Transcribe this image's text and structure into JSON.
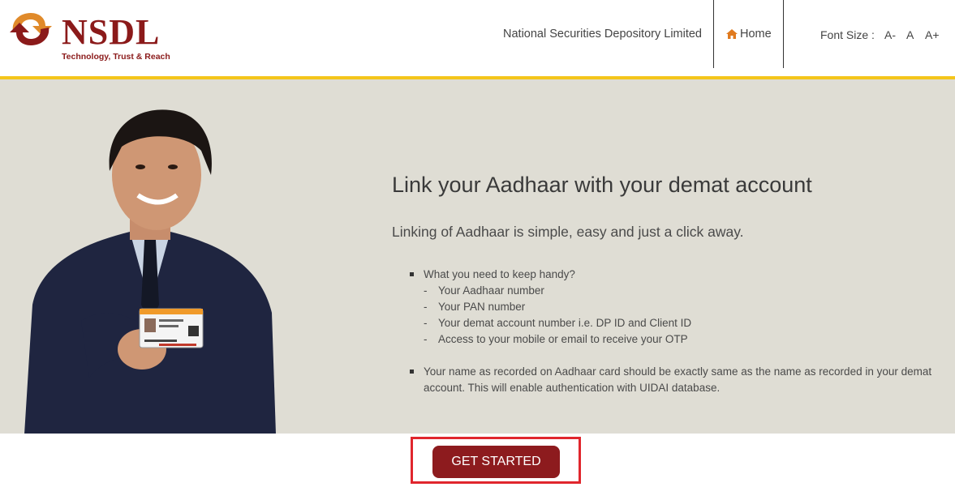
{
  "header": {
    "logo_name": "NSDL",
    "logo_tagline": "Technology, Trust & Reach",
    "org_name": "National Securities Depository Limited",
    "home_label": "Home",
    "font_size_label": "Font Size :",
    "font_decrease": "A-",
    "font_normal": "A",
    "font_increase": "A+"
  },
  "hero": {
    "headline": "Link your Aadhaar with your demat account",
    "subline": "Linking of Aadhaar is simple, easy and just a click away.",
    "bullet1": "What you need to keep handy?",
    "items": [
      "Your Aadhaar number",
      "Your PAN number",
      "Your demat account number i.e. DP ID and Client ID",
      "Access to your mobile or email to receive your OTP"
    ],
    "bullet2": "Your name as recorded on Aadhaar card should be exactly same as the name as recorded in your demat account. This will enable authentication with UIDAI database.",
    "dash": "-"
  },
  "cta": {
    "label": "GET STARTED"
  },
  "colors": {
    "brand": "#8b1a1a",
    "accent_bar": "#f4c51b",
    "hero_bg": "#dfddd4",
    "button": "#8d1b1e",
    "highlight": "#e0262d"
  },
  "icons": [
    "nsdl-logo-icon",
    "home-icon",
    "person-with-aadhaar-card-image"
  ]
}
